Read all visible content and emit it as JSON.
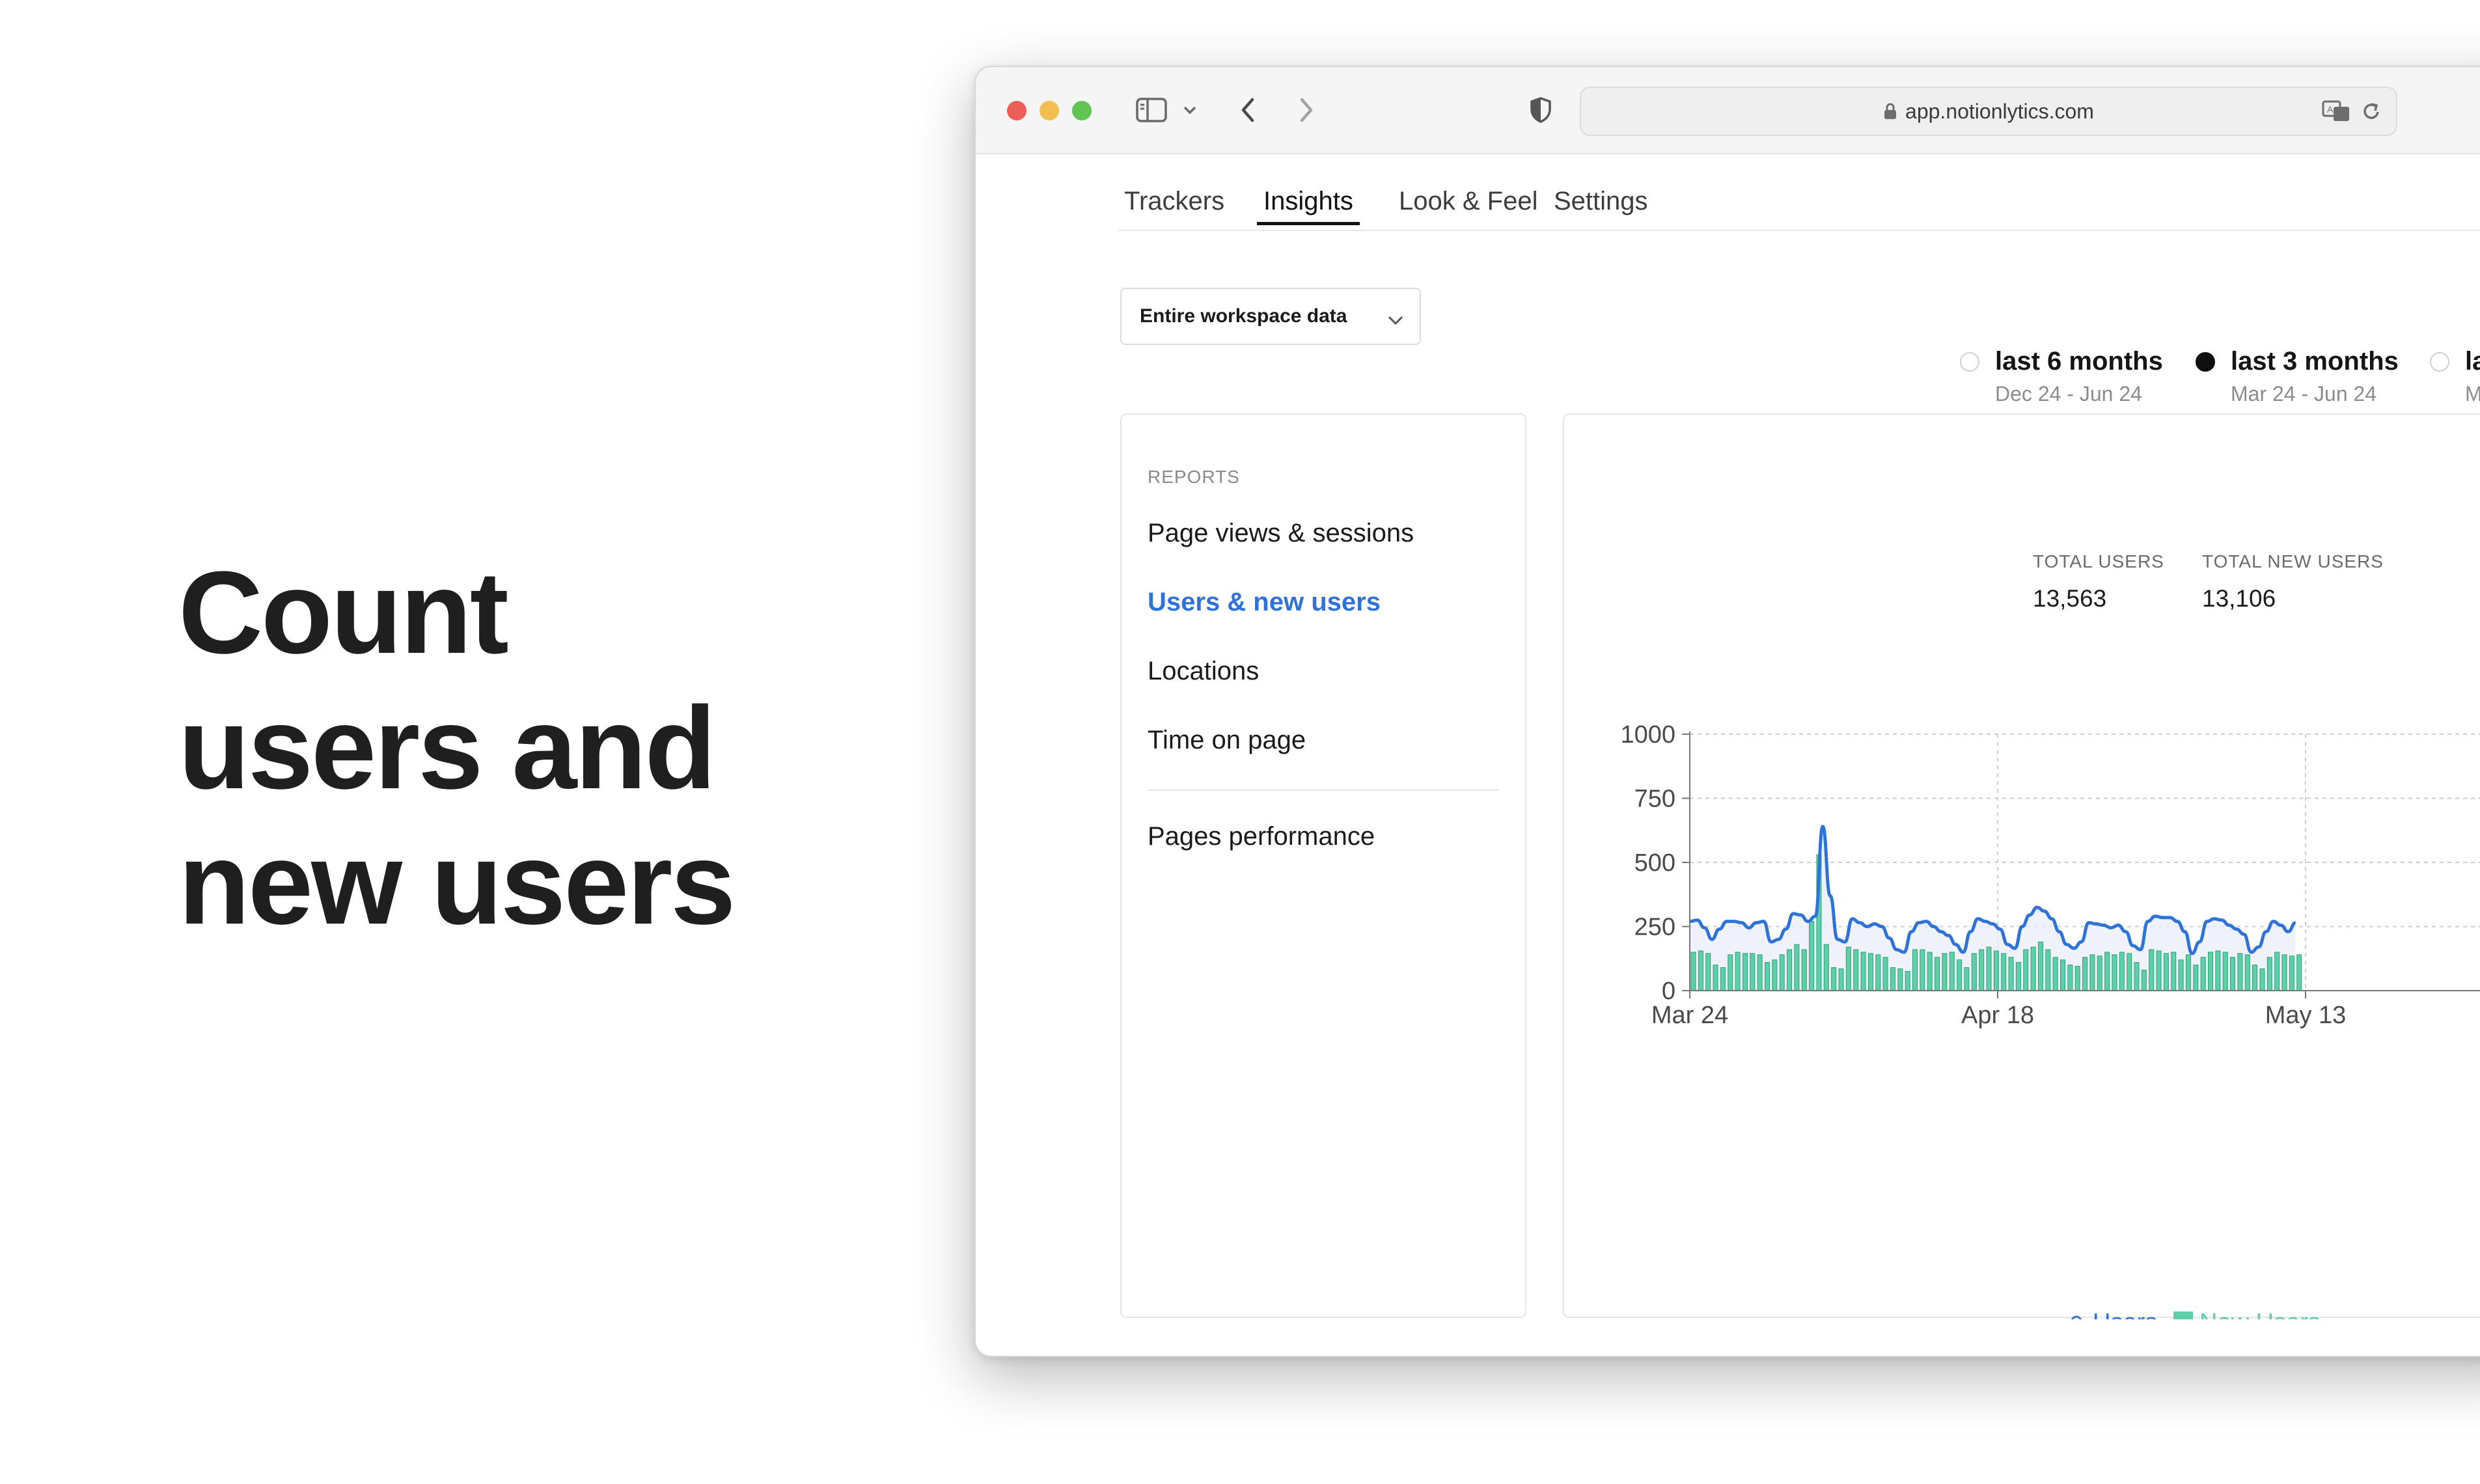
{
  "headline": [
    "Count",
    "users and",
    "new users"
  ],
  "browser": {
    "url": "app.notionlytics.com"
  },
  "tabs": [
    {
      "label": "Trackers",
      "active": false
    },
    {
      "label": "Insights",
      "active": true
    },
    {
      "label": "Look & Feel",
      "active": false
    },
    {
      "label": "Settings",
      "active": false
    }
  ],
  "filter": {
    "selected": "Entire workspace data"
  },
  "ranges": [
    {
      "label": "last 6 months",
      "sub": "Dec 24 - Jun 24",
      "selected": false
    },
    {
      "label": "last 3 months",
      "sub": "Mar 24 - Jun 24",
      "selected": true
    },
    {
      "label": "la",
      "sub": "M",
      "selected": false
    }
  ],
  "reports": {
    "heading": "REPORTS",
    "items": [
      {
        "label": "Page views & sessions",
        "active": false
      },
      {
        "label": "Users & new users",
        "active": true
      },
      {
        "label": "Locations",
        "active": false
      },
      {
        "label": "Time on page",
        "active": false
      },
      {
        "label": "Pages performance",
        "active": false
      }
    ]
  },
  "stats": {
    "total_users_label": "TOTAL USERS",
    "total_users": "13,563",
    "total_new_users_label": "TOTAL NEW USERS",
    "total_new_users": "13,106"
  },
  "colors": {
    "users_line": "#2f72d8",
    "users_fill": "#e9eefa",
    "new_users_bar": "#5dd0a8",
    "new_users_bar_edge": "#2f9f78",
    "active_link": "#2f72d8"
  },
  "chart_data": {
    "type": "line+bar",
    "y_ticks": [
      "0",
      "250",
      "500",
      "750",
      "1000"
    ],
    "x_ticks": [
      "Mar 24",
      "Apr 18",
      "May 13"
    ],
    "ylim": [
      0,
      1000
    ],
    "grid": true,
    "legend": {
      "position": "bottom-center",
      "items": [
        "Users",
        "New Users"
      ]
    },
    "series": [
      {
        "name": "Users",
        "type": "area-line",
        "values": [
          270,
          275,
          245,
          200,
          240,
          270,
          270,
          265,
          245,
          265,
          270,
          190,
          200,
          240,
          300,
          295,
          270,
          290,
          640,
          370,
          200,
          190,
          280,
          265,
          250,
          260,
          250,
          205,
          160,
          150,
          230,
          265,
          270,
          250,
          230,
          215,
          180,
          150,
          230,
          280,
          270,
          260,
          240,
          180,
          165,
          250,
          295,
          325,
          310,
          280,
          230,
          180,
          165,
          190,
          265,
          260,
          255,
          245,
          255,
          230,
          175,
          160,
          270,
          290,
          285,
          285,
          270,
          230,
          145,
          190,
          270,
          280,
          275,
          255,
          240,
          220,
          150,
          170,
          230,
          270,
          255,
          230,
          265
        ]
      },
      {
        "name": "New Users",
        "type": "bar",
        "values": [
          150,
          155,
          145,
          100,
          90,
          140,
          150,
          145,
          145,
          140,
          110,
          120,
          140,
          160,
          180,
          160,
          270,
          530,
          180,
          90,
          85,
          170,
          160,
          150,
          145,
          140,
          130,
          90,
          85,
          75,
          160,
          160,
          150,
          130,
          145,
          150,
          120,
          90,
          145,
          160,
          170,
          155,
          145,
          130,
          110,
          160,
          170,
          190,
          160,
          130,
          120,
          100,
          95,
          130,
          140,
          135,
          150,
          140,
          150,
          145,
          110,
          80,
          160,
          155,
          145,
          150,
          120,
          140,
          100,
          130,
          150,
          155,
          150,
          130,
          145,
          140,
          100,
          85,
          130,
          150,
          140,
          135,
          140
        ]
      }
    ]
  }
}
